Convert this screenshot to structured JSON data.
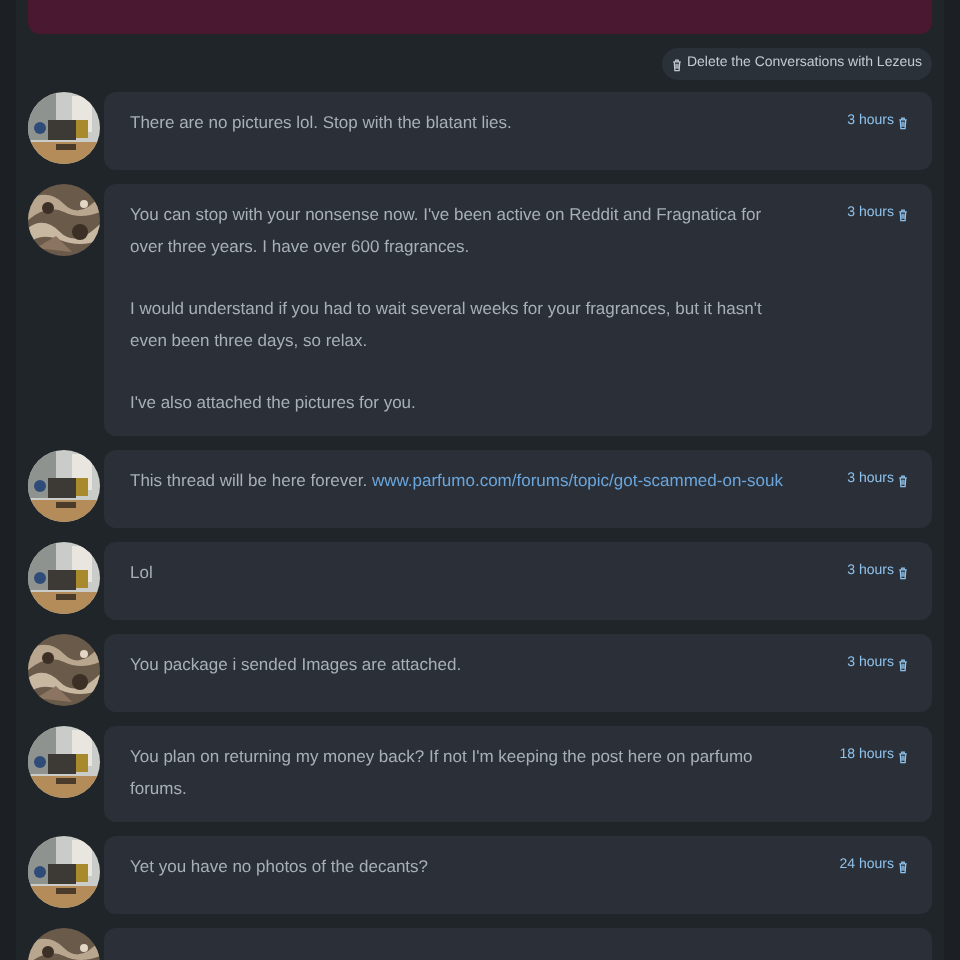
{
  "delete_button": {
    "label": "Delete the Conversations with Lezeus"
  },
  "messages": [
    {
      "avatar": {
        "kind": "room"
      },
      "paragraphs": [
        "There are no pictures lol. Stop with the blatant lies."
      ],
      "time": "3 hours"
    },
    {
      "avatar": {
        "kind": "texture"
      },
      "paragraphs": [
        "You can stop with your nonsense now. I've been active on Reddit and Fragnatica for over three years. I have over 600 fragrances.",
        "I would understand if you had to wait several weeks for your fragrances, but it hasn't even been three days, so relax.",
        "I've also attached the pictures for you."
      ],
      "time": "3 hours"
    },
    {
      "avatar": {
        "kind": "room"
      },
      "paragraphs": [
        "This thread will be here forever."
      ],
      "link": "www.parfumo.com/forums/topic/got-scammed-on-souk",
      "time": "3 hours"
    },
    {
      "avatar": {
        "kind": "room"
      },
      "paragraphs": [
        "Lol"
      ],
      "time": "3 hours"
    },
    {
      "avatar": {
        "kind": "texture"
      },
      "paragraphs": [
        "You package i sended Images are attached."
      ],
      "time": "3 hours"
    },
    {
      "avatar": {
        "kind": "room"
      },
      "paragraphs": [
        "You plan on returning my money back? If not I'm keeping the post here on parfumo forums."
      ],
      "time": "18 hours"
    },
    {
      "avatar": {
        "kind": "room"
      },
      "paragraphs": [
        "Yet you have no photos of the decants?"
      ],
      "time": "24 hours"
    },
    {
      "avatar": {
        "kind": "texture"
      }
    }
  ]
}
